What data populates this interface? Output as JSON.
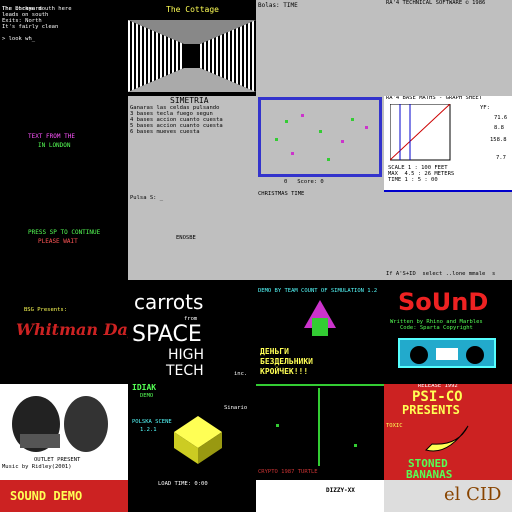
{
  "gallery": {
    "tiles": [
      {
        "name": "text-adventure",
        "lines": [
          "The Dockyard",
          "The chrome mouth here",
          "leads on south",
          "Exits: North",
          "It's fairly clean",
          "You see here",
          "a lantern",
          "a crowbar",
          "> GO NORTH",
          "You can't go",
          "that way",
          "> look",
          "You are in a",
          "dark room"
        ],
        "prompt": "> look wh_"
      },
      {
        "name": "corridor-demo",
        "title": "The Cottage"
      },
      {
        "name": "status-strip",
        "text": "Bolas: TIME"
      },
      {
        "name": "copyright-strip",
        "text": "RA'4 TECHNICAL SOFTWARE © 1986"
      },
      {
        "name": "dark-title",
        "line1": "TEXT FROM THE",
        "line2": "IN LONDON",
        "line3": "PRESS SP TO CONTINUE",
        "line4": "PLEASE WAIT"
      },
      {
        "name": "simetria",
        "title": "SIMETRIA",
        "lines": [
          "Ganaras las celdas pulsando",
          "3 bases tecla fuego segun",
          "4 bases accion cuanto cuesta",
          "5 bases accion cuanto cuesta",
          "6 bases mueves cuesta"
        ],
        "prompt": "Pulsa S: _",
        "footer": "ENOSBE"
      },
      {
        "name": "christmas-time",
        "score": "0   Score: 0",
        "caption": "CHRISTMAS TIME"
      },
      {
        "name": "graph-tool",
        "title": "RA'4 BASE MATHS - GRAPH SHEET",
        "side": [
          "YF:",
          "71.6",
          "8.8",
          "158.8",
          "7.7"
        ],
        "lines": [
          "SCALE 1 : 100 FEET",
          "MAX  4.5 : 26 METERS",
          "TIME 1 : 5 : 00"
        ]
      },
      {
        "name": "loading-notes",
        "lines": [
          "If A'S+ID  select ..lone mmale  s",
          "  rendered with program data  y",
          "at the 1 xoom  LOAD"
        ]
      },
      {
        "name": "whitman-day",
        "kicker": "BSG Presents:",
        "title": "Whitman Day"
      },
      {
        "name": "carrots",
        "line1": "carrots",
        "line2": "from",
        "line3": "SPACE",
        "line4": "HIGH",
        "line5": "TECH",
        "tag": "inc."
      },
      {
        "name": "ammo-demo",
        "line1": "ДЕНЬГИ",
        "line2": "БЕЗДЕЛЬНИКИ",
        "line3": "КРОЙЧЕК!!!",
        "header": "DEMO BY TEAM COUNT OF SIMULATION 1.2"
      },
      {
        "name": "sound-title",
        "title": "SoUnD",
        "line1": "Written by Rhino and Marbles",
        "line2": "Code: Sparta Copyright"
      },
      {
        "name": "drowning",
        "caption": "OUTLET PRESENT",
        "line2": "Music by Ridley(2001)"
      },
      {
        "name": "idiak-demo",
        "title": "IDIAK",
        "sub": "DEMO",
        "lines": [
          "Sinario",
          "POLSKA SCENE",
          "1.2.1"
        ]
      },
      {
        "name": "scope-screen",
        "bottom": "CRYPTO 1987 TURTLE"
      },
      {
        "name": "psi-co",
        "year": "RELEASE 1992",
        "line1": "PSI-CO",
        "line2": "PRESENTS",
        "side": "TOXIC",
        "line3": "STONED",
        "line4": "BANANAS"
      },
      {
        "name": "sound-demo",
        "title": "SOUND DEMO"
      },
      {
        "name": "load-time",
        "text": "LOAD TIME: 0:00"
      },
      {
        "name": "dizzy",
        "title": "DIZZY-XX"
      },
      {
        "name": "el-cid",
        "title": "el CID"
      }
    ]
  }
}
